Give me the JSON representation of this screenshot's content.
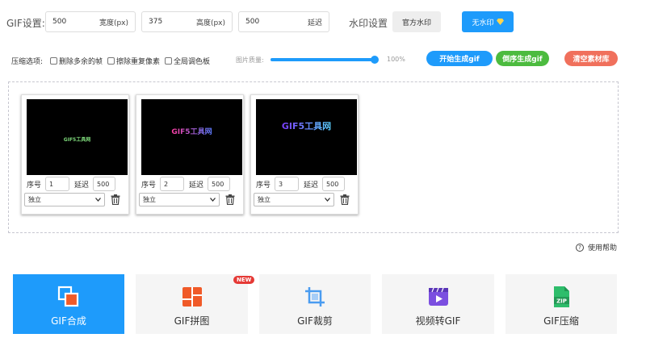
{
  "settings": {
    "gif_label": "GIF设置:",
    "width_value": "500",
    "width_unit": "宽度(px)",
    "height_value": "375",
    "height_unit": "高度(px)",
    "delay_value": "500",
    "delay_unit": "延迟",
    "watermark_label": "水印设置",
    "official_watermark": "官方水印",
    "no_watermark": "无水印"
  },
  "options": {
    "compress_label": "压缩选项:",
    "remove_extra_frames": "删除多余的帧",
    "erase_duplicate_pixels": "擦除重复像素",
    "global_palette": "全局调色板",
    "quality_label": "图片质量:",
    "quality_value": 1.0,
    "quality_text": "100%",
    "start_button": "开始生成gif",
    "reverse_button": "倒序生成gif",
    "clear_button": "清空素材库"
  },
  "frames": [
    {
      "preview_text": "GIF5工具网",
      "order_label": "序号",
      "order": "1",
      "delay_label": "延迟",
      "delay": "500",
      "mode": "独立"
    },
    {
      "preview_text": "GIF5工具网",
      "order_label": "序号",
      "order": "2",
      "delay_label": "延迟",
      "delay": "500",
      "mode": "独立"
    },
    {
      "preview_text": "GIF5工具网",
      "order_label": "序号",
      "order": "3",
      "delay_label": "延迟",
      "delay": "500",
      "mode": "独立"
    }
  ],
  "help": "使用帮助",
  "tools": [
    {
      "label": "GIF合成",
      "active": true
    },
    {
      "label": "GIF拼图",
      "badge": "NEW"
    },
    {
      "label": "GIF裁剪"
    },
    {
      "label": "视频转GIF"
    },
    {
      "label": "GIF压缩",
      "icon_text": "ZIP"
    }
  ],
  "colors": {
    "accent": "#1e9bfb",
    "green": "#4cbb3f",
    "salmon": "#f0705c"
  }
}
